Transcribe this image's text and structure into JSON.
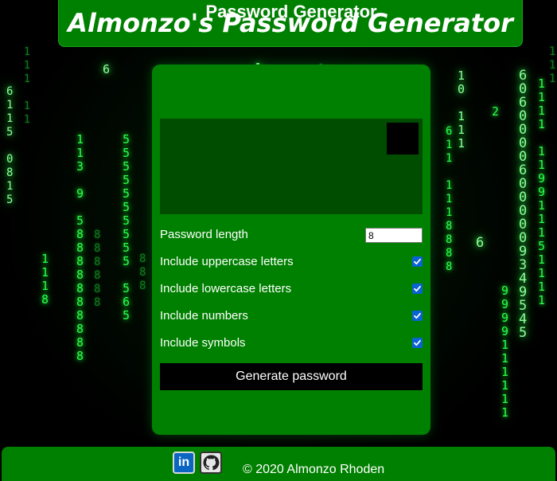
{
  "header": {
    "title": "Almonzo's Password Generator"
  },
  "card": {
    "title": "Password Generator",
    "password_output": "",
    "options": {
      "length_label": "Password length",
      "length_value": "8",
      "uppercase_label": "Include uppercase letters",
      "uppercase_checked": true,
      "lowercase_label": "Include lowercase letters",
      "lowercase_checked": true,
      "numbers_label": "Include numbers",
      "numbers_checked": true,
      "symbols_label": "Include symbols",
      "symbols_checked": true
    },
    "generate_button_label": "Generate password"
  },
  "footer": {
    "linkedin_icon": "linkedin-icon",
    "github_icon": "github-icon",
    "copyright": "© 2020 Almonzo Rhoden"
  },
  "colors": {
    "primary_green": "#008000",
    "dark_green": "#004d00",
    "checkbox_blue": "#0a63d4",
    "linkedin_blue": "#0a66c2"
  }
}
